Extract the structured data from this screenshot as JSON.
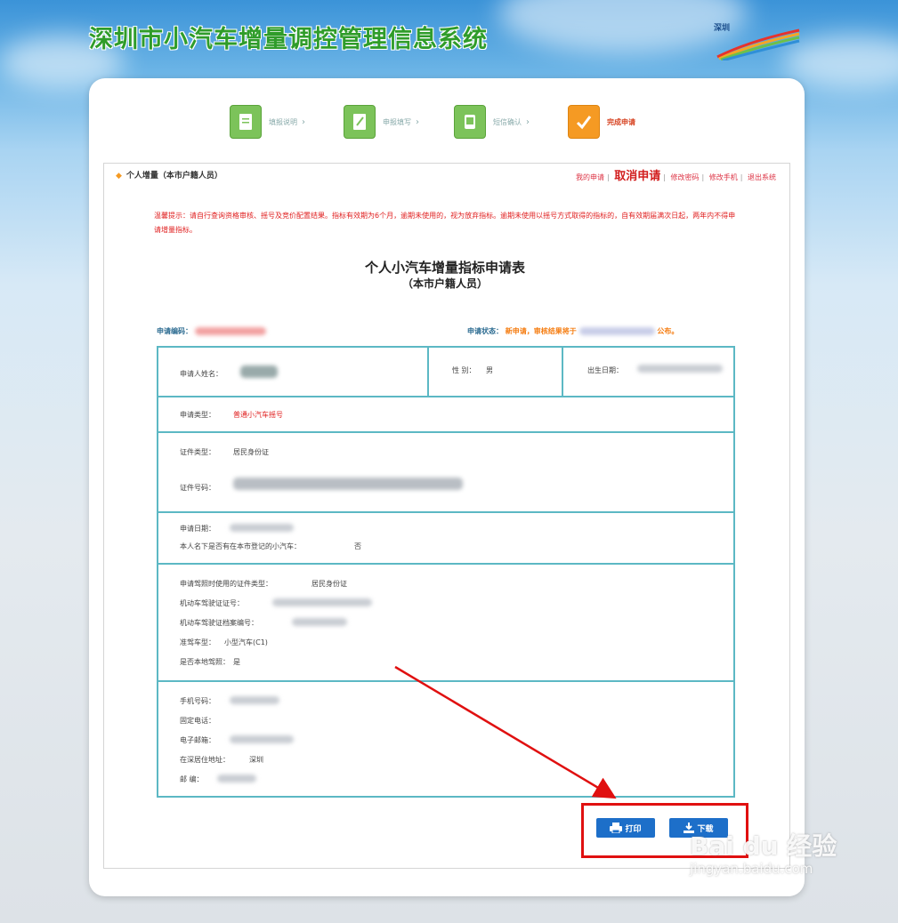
{
  "header": {
    "system_title": "深圳市小汽车增量调控管理信息系统",
    "logo_text": "深圳"
  },
  "steps": [
    {
      "label": "填报说明"
    },
    {
      "label": "申报填写"
    },
    {
      "label": "短信确认"
    },
    {
      "label": "完成申请"
    }
  ],
  "topbar": {
    "breadcrumb": "个人增量（本市户籍人员）",
    "links": {
      "my_apply": "我的申请",
      "cancel": "取消申请",
      "change_pwd": "修改密码",
      "change_phone": "修改手机",
      "logout": "退出系统"
    }
  },
  "notice": "温馨提示：请自行查询资格审核、摇号及竞价配置结果。指标有效期为6个月，逾期未使用的，视为放弃指标。逾期未使用以摇号方式取得的指标的，自有效期届满次日起，两年内不得申请增量指标。",
  "form": {
    "title": "个人小汽车增量指标申请表",
    "subtitle": "（本市户籍人员）",
    "apply_no_label": "申请编码：",
    "status_label": "申请状态：",
    "status_value": "新申请，审核结果将于",
    "status_suffix": "公布。"
  },
  "table": {
    "applicant_name_label": "申请人姓名：",
    "gender_label": "性 别：",
    "gender_value": "男",
    "birth_label": "出生日期：",
    "apply_type_label": "申请类型：",
    "apply_type_value": "普通小汽车摇号",
    "id_type_label": "证件类型：",
    "id_type_value": "居民身份证",
    "id_no_label": "证件号码：",
    "apply_date_label": "申请日期：",
    "car_question": "本人名下是否有在本市登记的小汽车：",
    "car_answer": "否",
    "license_id_type_label": "申请驾照时使用的证件类型：",
    "license_id_type_value": "居民身份证",
    "license_no_label": "机动车驾驶证证号：",
    "license_file_label": "机动车驾驶证档案编号：",
    "license_class_label": "准驾车型：",
    "license_class_value": "小型汽车(C1)",
    "local_license_label": "是否本地驾照：",
    "local_license_value": "是",
    "phone_label": "手机号码：",
    "tel_label": "固定电话：",
    "email_label": "电子邮箱：",
    "address_label": "在深居住地址：",
    "address_value": "深圳",
    "postcode_label": "邮    编："
  },
  "buttons": {
    "print": "打印",
    "download": "下载"
  },
  "watermark": {
    "main": "Bai du 经验",
    "sub": "jingyan.baidu.com"
  }
}
